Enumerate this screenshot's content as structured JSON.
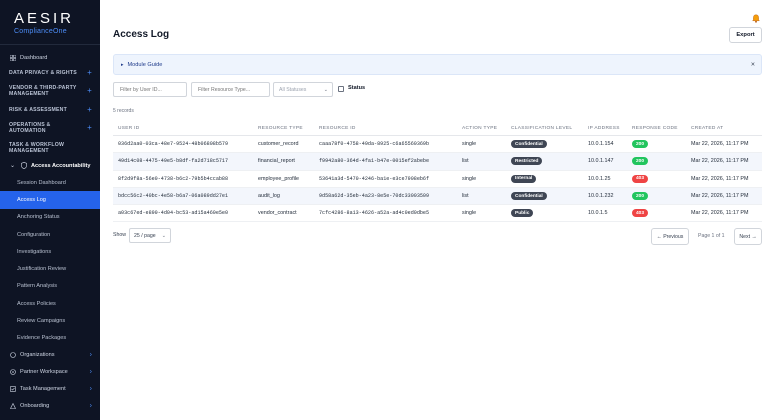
{
  "brand": {
    "name": "AESIR",
    "sub": "ComplianceOne"
  },
  "sidebar": {
    "dashboard": "Dashboard",
    "sections": [
      "DATA PRIVACY & RIGHTS",
      "VENDOR & THIRD-PARTY MANAGEMENT",
      "RISK & ASSESSMENT",
      "OPERATIONS & AUTOMATION",
      "TASK & WORKFLOW MANAGEMENT"
    ],
    "group": "Access Accountability",
    "sub_items": [
      "Session Dashboard",
      "Access Log",
      "Anchoring Status",
      "Configuration",
      "Investigations",
      "Justification Review",
      "Pattern Analysis",
      "Access Policies",
      "Review Campaigns",
      "Evidence Packages"
    ],
    "bottom_items": [
      "Organizations",
      "Partner Workspace",
      "Task Management",
      "Onboarding"
    ]
  },
  "page": {
    "title": "Access Log",
    "export_label": "Export",
    "guide_label": "Module Guide",
    "guide_close": "×"
  },
  "filters": {
    "user_placeholder": "Filter by User ID...",
    "resource_placeholder": "Filter Resource Type...",
    "status_select": "All Statuses",
    "status_label": "Status"
  },
  "records_count": "5 records",
  "table": {
    "headers": [
      "USER ID",
      "RESOURCE TYPE",
      "RESOURCE ID",
      "ACTION TYPE",
      "CLASSIFICATION LEVEL",
      "IP ADDRESS",
      "RESPONSE CODE",
      "CREATED AT"
    ],
    "rows": [
      {
        "user_id": "036d2aa0-03ca-48e7-9524-48b06808b579",
        "resource_type": "customer_record",
        "resource_id": "caaa78f0-4758-49da-8925-c6a65560369b",
        "action": "single",
        "classification": "Confidential",
        "ip": "10.0.1.154",
        "code": "200",
        "code_color": "#22c55e",
        "created": "Mar 22, 2026, 11:17 PM"
      },
      {
        "user_id": "49d14c08-4475-49e5-b8df-fa2d718c5717",
        "resource_type": "financial_report",
        "resource_id": "f9942a80-364d-4fa1-b47e-0015ef2abebe",
        "action": "list",
        "classification": "Restricted",
        "ip": "10.0.1.147",
        "code": "200",
        "code_color": "#22c55e",
        "created": "Mar 22, 2026, 11:17 PM"
      },
      {
        "user_id": "8f2d9f8a-56e0-4738-b6c2-79b5b4ccab88",
        "resource_type": "employee_profile",
        "resource_id": "53641a3d-5470-4246-ba1e-e3ce7908eb6f",
        "action": "single",
        "classification": "Internal",
        "ip": "10.0.1.25",
        "code": "403",
        "code_color": "#ef4444",
        "created": "Mar 22, 2026, 11:17 PM"
      },
      {
        "user_id": "bdcc56c2-40bc-4e58-b6a7-06a089dd27e1",
        "resource_type": "audit_log",
        "resource_id": "9d58a62d-35eb-4a23-8e5e-70dc33003509",
        "action": "list",
        "classification": "Confidential",
        "ip": "10.0.1.232",
        "code": "200",
        "code_color": "#22c55e",
        "created": "Mar 22, 2026, 11:17 PM"
      },
      {
        "user_id": "a03c67ed-e890-4d04-bc53-ad15a460e5e0",
        "resource_type": "vendor_contract",
        "resource_id": "7cfc4286-8a13-4626-a52a-ad4c0ed0dbe5",
        "action": "single",
        "classification": "Public",
        "ip": "10.0.1.5",
        "code": "403",
        "code_color": "#ef4444",
        "created": "Mar 22, 2026, 11:17 PM"
      }
    ]
  },
  "pagination": {
    "show_label": "Show",
    "per_page": "25 / page",
    "prev_label": "← Previous",
    "page_info": "Page 1 of 1",
    "next_label": "Next →"
  },
  "colors": {
    "sidebar_bg": "#0e1424",
    "accent": "#2563eb",
    "success": "#22c55e",
    "danger": "#ef4444"
  }
}
